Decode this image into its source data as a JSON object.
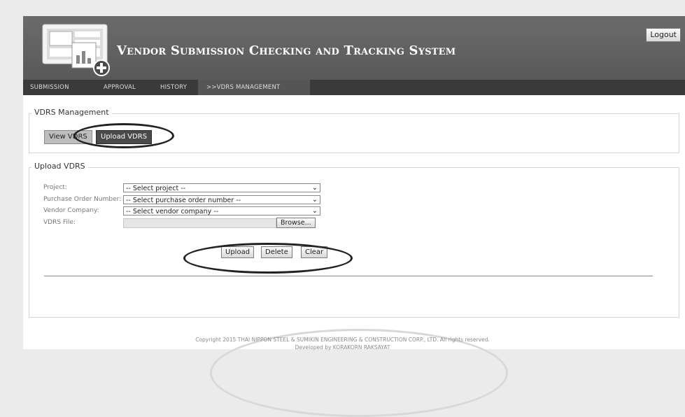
{
  "header": {
    "title": "Vendor Submission Checking and Tracking System",
    "logout_label": "Logout",
    "logo_icon": "monitor-plus-icon"
  },
  "nav": {
    "items": [
      {
        "label": "SUBMISSION"
      },
      {
        "label": "APPROVAL"
      },
      {
        "label": "HISTORY"
      },
      {
        "label": ">>VDRS MANAGEMENT",
        "active": true
      }
    ]
  },
  "management": {
    "legend": "VDRS Management",
    "view_label": "View VDRS",
    "upload_label": "Upload VDRS"
  },
  "upload": {
    "legend": "Upload VDRS",
    "project_label": "Project:",
    "project_value": "-- Select project --",
    "po_label": "Purchase Order Number:",
    "po_value": "-- Select purchase order number --",
    "vendor_label": "Vendor Company:",
    "vendor_value": "-- Select vendor company --",
    "file_label": "VDRS File:",
    "browse_label": "Browse...",
    "upload_btn": "Upload",
    "delete_btn": "Delete",
    "clear_btn": "Clear"
  },
  "footer": {
    "copyright": "Copyright 2015 THAI NIPPON STEEL & SUMIKIN ENGINEERING & CONSTRUCTION CORP., LTD. All rights reserved.",
    "developer": "Developed by KORAKORN RAKSAYAT"
  },
  "colors": {
    "header_bg": "#616161",
    "nav_bg": "#3a3a3a",
    "nav_active_bg": "#555555",
    "upload_tab_bg": "#4a4a4a",
    "view_tab_bg": "#bdbdbd"
  }
}
